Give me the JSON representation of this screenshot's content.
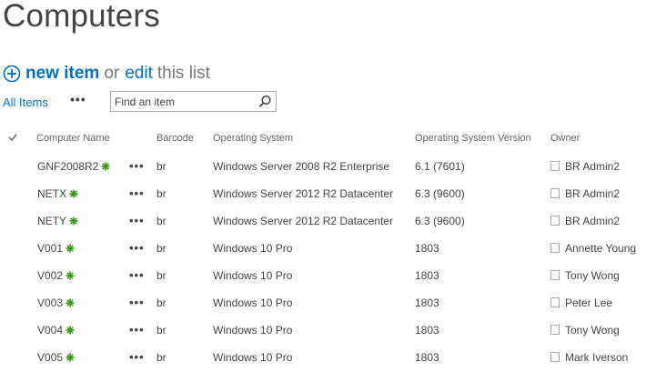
{
  "page": {
    "title": "Computers"
  },
  "actions": {
    "new_item": "new item",
    "or": "or",
    "edit": "edit",
    "this_list": "this list"
  },
  "view": {
    "all_items": "All Items",
    "more": "•••",
    "search_placeholder": "Find an item"
  },
  "columns": {
    "computer_name": "Computer Name",
    "barcode": "Barcode",
    "operating_system": "Operating System",
    "os_version": "Operating System Version",
    "owner": "Owner"
  },
  "rows": [
    {
      "name": "GNF2008R2",
      "more": "•••",
      "barcode": "br",
      "os": "Windows Server 2008 R2 Enterprise",
      "os_version": "6.1 (7601)",
      "owner": "BR Admin2"
    },
    {
      "name": "NETX",
      "more": "•••",
      "barcode": "br",
      "os": "Windows Server 2012 R2 Datacenter",
      "os_version": "6.3 (9600)",
      "owner": "BR Admin2"
    },
    {
      "name": "NETY",
      "more": "•••",
      "barcode": "br",
      "os": "Windows Server 2012 R2 Datacenter",
      "os_version": "6.3 (9600)",
      "owner": "BR Admin2"
    },
    {
      "name": "V001",
      "more": "•••",
      "barcode": "br",
      "os": "Windows 10 Pro",
      "os_version": "1803",
      "owner": "Annette Young"
    },
    {
      "name": "V002",
      "more": "•••",
      "barcode": "br",
      "os": "Windows 10 Pro",
      "os_version": "1803",
      "owner": "Tony Wong"
    },
    {
      "name": "V003",
      "more": "•••",
      "barcode": "br",
      "os": "Windows 10 Pro",
      "os_version": "1803",
      "owner": "Peter Lee"
    },
    {
      "name": "V004",
      "more": "•••",
      "barcode": "br",
      "os": "Windows 10 Pro",
      "os_version": "1803",
      "owner": "Tony Wong"
    },
    {
      "name": "V005",
      "more": "•••",
      "barcode": "br",
      "os": "Windows 10 Pro",
      "os_version": "1803",
      "owner": "Mark Iverson"
    }
  ],
  "colors": {
    "link": "#0072c6",
    "text": "#444444",
    "new_badge": "#3a9a15"
  },
  "icons": {
    "new_item": "plus-circle-icon",
    "search": "search-icon",
    "select_all": "checkmark-icon",
    "new_badge": "new-asterisk-icon",
    "owner_presence": "presence-icon"
  }
}
